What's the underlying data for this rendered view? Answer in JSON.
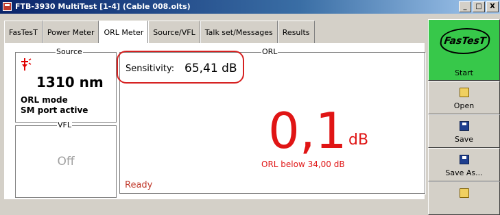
{
  "window": {
    "title": "FTB-3930 MultiTest [1-4] (Cable 008.olts)",
    "buttons": [
      "_",
      "□",
      "X"
    ]
  },
  "tabs": [
    "FasTesT",
    "Power Meter",
    "ORL Meter",
    "Source/VFL",
    "Talk set/Messages",
    "Results"
  ],
  "active_tab": "ORL Meter",
  "source": {
    "legend": "Source",
    "wavelength": "1310 nm",
    "mode_line1": "ORL mode",
    "mode_line2": "SM port active",
    "icon": "laser-icon"
  },
  "vfl": {
    "legend": "VFL",
    "state": "Off"
  },
  "orl": {
    "legend": "ORL",
    "sensitivity_label": "Sensitivity:",
    "sensitivity_value": "65,41 dB",
    "value": "0,1",
    "unit": "dB",
    "note": "ORL below 34,00 dB",
    "status": "Ready",
    "value_color": "#e01515"
  },
  "sidebar": {
    "start_logo": "FasTesT",
    "start_label": "Start",
    "buttons": [
      {
        "label": "Open",
        "icon": "folder-open-icon"
      },
      {
        "label": "Save",
        "icon": "floppy-disk-icon"
      },
      {
        "label": "Save As...",
        "icon": "floppy-disk-icon"
      },
      {
        "label": "",
        "icon": "folder-icon"
      }
    ]
  }
}
